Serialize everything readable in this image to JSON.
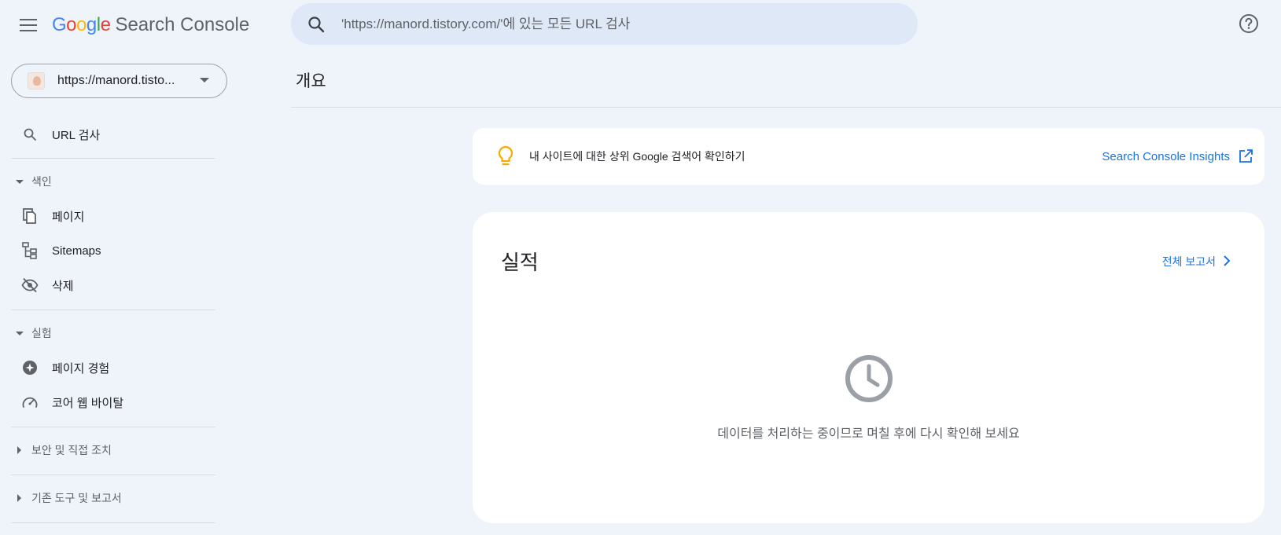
{
  "header": {
    "logo_google": "Google",
    "logo_product": "Search Console",
    "search_placeholder": "'https://manord.tistory.com/'에 있는 모든 URL 검사",
    "menu_icon": "hamburger-menu-icon",
    "help_icon": "help-circle-icon",
    "search_icon": "search-icon"
  },
  "sidebar": {
    "property_url": "https://manord.tisto...",
    "url_inspection": "URL 검사",
    "sections": {
      "index": "색인",
      "experience": "실험",
      "security": "보안 및 직접 조치",
      "legacy": "기존 도구 및 보고서"
    },
    "items": {
      "pages": "페이지",
      "sitemaps": "Sitemaps",
      "removals": "삭제",
      "page_experience": "페이지 경험",
      "core_web_vitals": "코어 웹 바이탈"
    }
  },
  "main": {
    "page_title": "개요",
    "insight_text": "내 사이트에 대한 상위 Google 검색어 확인하기",
    "insight_link": "Search Console Insights",
    "performance_title": "실적",
    "full_report": "전체 보고서",
    "processing_message": "데이터를 처리하는 중이므로 며칠 후에 다시 확인해 보세요"
  },
  "colors": {
    "background": "#eff3fa",
    "search_bg": "#dfe8f7",
    "link_blue": "#1a73e8",
    "bulb_amber": "#f9ab00"
  }
}
